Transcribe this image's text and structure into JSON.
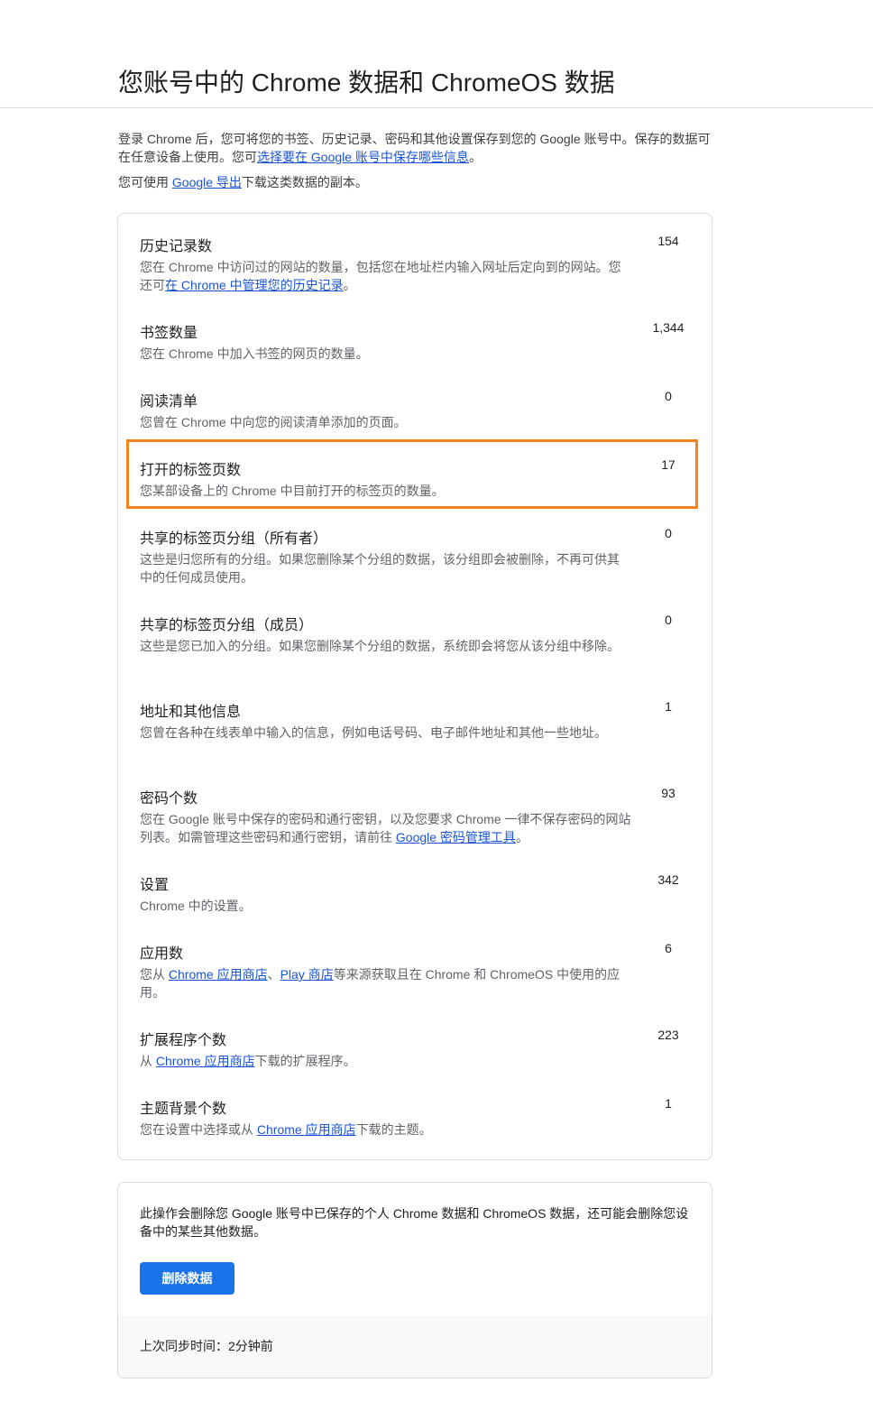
{
  "page": {
    "title": "您账号中的 Chrome 数据和 ChromeOS 数据"
  },
  "intro": {
    "line1_prefix": "登录 Chrome 后，您可将您的书签、历史记录、密码和其他设置保存到您的 Google 账号中。保存的数据可在任意设备上使用。您可",
    "line1_link": "选择要在 Google 账号中保存哪些信息",
    "line1_suffix": "。",
    "line2_prefix": "您可使用 ",
    "line2_link": "Google 导出",
    "line2_suffix": "下载这类数据的副本。"
  },
  "stats": [
    {
      "title": "历史记录数",
      "value": "154",
      "desc_prefix": "您在 Chrome 中访问过的网站的数量，包括您在地址栏内输入网址后定向到的网站。您还可",
      "desc_link": "在 Chrome 中管理您的历史记录",
      "desc_suffix": "。"
    },
    {
      "title": "书签数量",
      "value": "1,344",
      "desc_prefix": "您在 Chrome 中加入书签的网页的数量。"
    },
    {
      "title": "阅读清单",
      "value": "0",
      "desc_prefix": "您曾在 Chrome 中向您的阅读清单添加的页面。"
    },
    {
      "title": "打开的标签页数",
      "value": "17",
      "desc_prefix": "您某部设备上的 Chrome 中目前打开的标签页的数量。"
    },
    {
      "title": "共享的标签页分组（所有者）",
      "value": "0",
      "desc_prefix": "这些是归您所有的分组。如果您删除某个分组的数据，该分组即会被删除，不再可供其中的任何成员使用。"
    },
    {
      "title": "共享的标签页分组（成员）",
      "value": "0",
      "desc_prefix": "这些是您已加入的分组。如果您删除某个分组的数据，系统即会将您从该分组中移除。"
    },
    {
      "title": "地址和其他信息",
      "value": "1",
      "desc_prefix": "您曾在各种在线表单中输入的信息，例如电话号码、电子邮件地址和其他一些地址。"
    },
    {
      "title": "密码个数",
      "value": "93",
      "desc_prefix": "您在 Google 账号中保存的密码和通行密钥，以及您要求 Chrome 一律不保存密码的网站列表。如需管理这些密码和通行密钥，请前往 ",
      "desc_link": "Google 密码管理工具",
      "desc_suffix": "。"
    },
    {
      "title": "设置",
      "value": "342",
      "desc_prefix": "Chrome 中的设置。"
    },
    {
      "title": "应用数",
      "value": "6",
      "desc_prefix": "您从 ",
      "desc_link": "Chrome 应用商店",
      "desc_mid": "、",
      "desc_link2": "Play 商店",
      "desc_suffix": "等来源获取且在 Chrome 和 ChromeOS 中使用的应用。"
    },
    {
      "title": "扩展程序个数",
      "value": "223",
      "desc_prefix": "从 ",
      "desc_link": "Chrome 应用商店",
      "desc_suffix": "下载的扩展程序。"
    },
    {
      "title": "主题背景个数",
      "value": "1",
      "desc_prefix": "您在设置中选择或从 ",
      "desc_link": "Chrome 应用商店",
      "desc_suffix": "下载的主题。"
    }
  ],
  "delete_card": {
    "text": "此操作会删除您 Google 账号中已保存的个人 Chrome 数据和 ChromeOS 数据，还可能会删除您设备中的某些其他数据。",
    "button_label": "删除数据",
    "button_color": "#1a73e8",
    "sync_status": "上次同步时间：2分钟前"
  },
  "highlight": {
    "color": "#f5821f"
  }
}
